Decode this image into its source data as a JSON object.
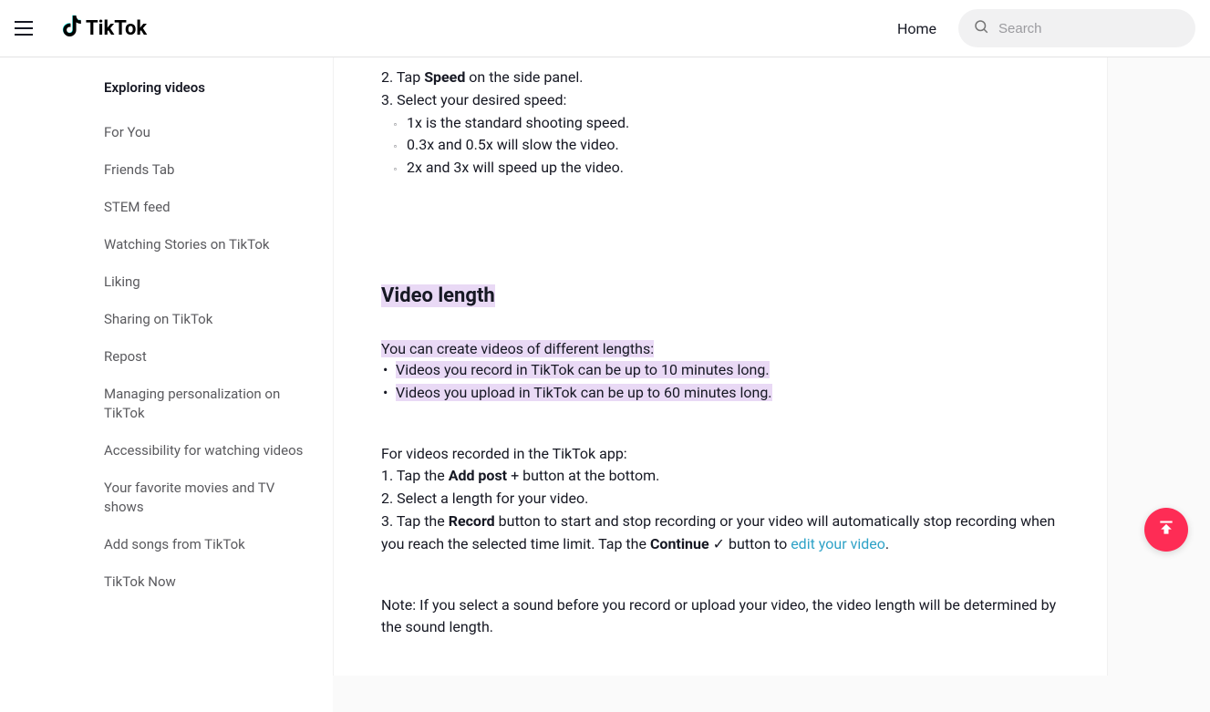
{
  "header": {
    "logo_text": "TikTok",
    "home_label": "Home",
    "search_placeholder": "Search"
  },
  "sidebar": {
    "heading": "Exploring videos",
    "items": [
      "For You",
      "Friends Tab",
      "STEM feed",
      "Watching Stories on TikTok",
      "Liking",
      "Sharing on TikTok",
      "Repost",
      "Managing personalization on TikTok",
      "Accessibility for watching videos",
      "Your favorite movies and TV shows",
      "Add songs from TikTok",
      "TikTok Now"
    ]
  },
  "article": {
    "step2_prefix": "2. Tap ",
    "step2_bold": "Speed",
    "step2_suffix": " on the side panel.",
    "step3": "3. Select your desired speed:",
    "speed_opts": [
      "1x is the standard shooting speed.",
      "0.3x and 0.5x will slow the video.",
      "2x and 3x will speed up the video."
    ],
    "heading": "Video length",
    "intro": "You can create videos of different lengths:",
    "lengths": [
      "Videos you record in TikTok can be up to 10 minutes long.",
      "Videos you upload in TikTok can be up to 60 minutes long."
    ],
    "recorded_intro": "For videos recorded in the TikTok app:",
    "rstep1_prefix": "1. Tap the ",
    "rstep1_bold": "Add post",
    "rstep1_suffix": " + button at the bottom.",
    "rstep2": "2. Select a length for your video.",
    "rstep3_prefix": "3. Tap the ",
    "rstep3_bold1": "Record",
    "rstep3_mid": " button to start and stop recording or your video will automatically stop recording when you reach the selected time limit. Tap the ",
    "rstep3_bold2": "Continue",
    "rstep3_check": " ✓ button to ",
    "rstep3_link": "edit your video",
    "rstep3_end": ".",
    "note": "Note: If you select a sound before you record or upload your video, the video length will be determined by the sound length."
  }
}
